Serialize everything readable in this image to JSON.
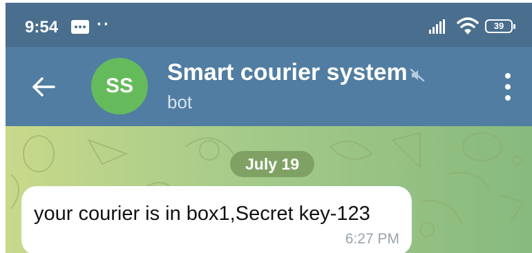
{
  "status_bar": {
    "time": "9:54",
    "extra_dots": "··",
    "battery": "39",
    "icons": [
      "message-icon",
      "signal-icon",
      "wifi-icon",
      "battery-icon"
    ]
  },
  "header": {
    "avatar_initials": "SS",
    "title": "Smart courier system",
    "subtitle": "bot",
    "icons": [
      "back-arrow-icon",
      "mute-icon",
      "more-vert-icon"
    ]
  },
  "chat": {
    "date_label": "July 19",
    "messages": [
      {
        "text": "your courier is in box1,Secret key-123",
        "time": "6:27 PM"
      }
    ]
  },
  "colors": {
    "status_bar": "#4a6e8e",
    "header": "#517da2",
    "avatar": "#65bb5b",
    "date_pill": "#7fa264",
    "bubble": "#ffffff"
  }
}
